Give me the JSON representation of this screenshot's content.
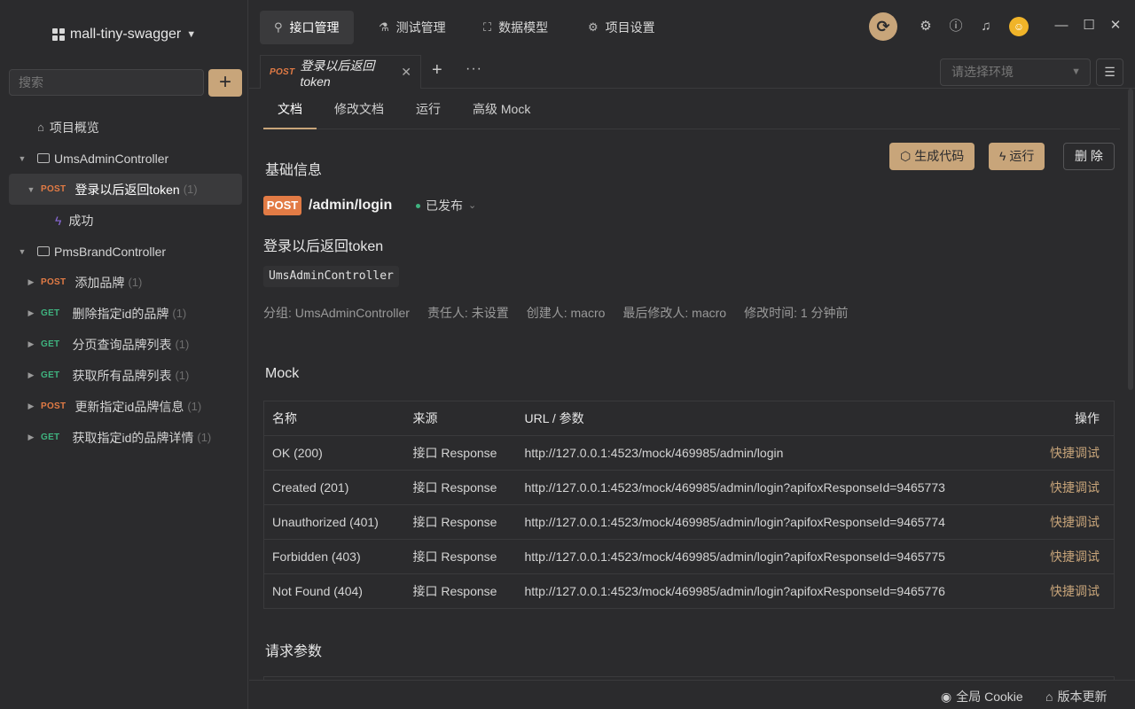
{
  "project": {
    "name": "mall-tiny-swagger"
  },
  "search": {
    "placeholder": "搜索"
  },
  "add_label": "+",
  "tree": [
    {
      "kind": "overview",
      "label": "项目概览"
    },
    {
      "kind": "folder",
      "label": "UmsAdminController"
    },
    {
      "kind": "api",
      "method": "POST",
      "label": "登录以后返回token",
      "count": "(1)",
      "active": true
    },
    {
      "kind": "case",
      "label": "成功"
    },
    {
      "kind": "folder",
      "label": "PmsBrandController"
    },
    {
      "kind": "api",
      "method": "POST",
      "label": "添加品牌",
      "count": "(1)"
    },
    {
      "kind": "api",
      "method": "GET",
      "label": "删除指定id的品牌",
      "count": "(1)"
    },
    {
      "kind": "api",
      "method": "GET",
      "label": "分页查询品牌列表",
      "count": "(1)"
    },
    {
      "kind": "api",
      "method": "GET",
      "label": "获取所有品牌列表",
      "count": "(1)"
    },
    {
      "kind": "api",
      "method": "POST",
      "label": "更新指定id品牌信息",
      "count": "(1)"
    },
    {
      "kind": "api",
      "method": "GET",
      "label": "获取指定id的品牌详情",
      "count": "(1)"
    }
  ],
  "nav": {
    "tabs": [
      {
        "label": "接口管理",
        "icon": "link-icon"
      },
      {
        "label": "测试管理",
        "icon": "flask-icon"
      },
      {
        "label": "数据模型",
        "icon": "model-icon"
      },
      {
        "label": "项目设置",
        "icon": "gear-icon"
      }
    ]
  },
  "doctab": {
    "method": "POST",
    "label": "登录以后返回token"
  },
  "env": {
    "placeholder": "请选择环境"
  },
  "subtabs": [
    "文档",
    "修改文档",
    "运行",
    "高级 Mock"
  ],
  "doc": {
    "basic_title": "基础信息",
    "gen_code": "生成代码",
    "run": "运行",
    "delete": "删 除",
    "method": "POST",
    "path": "/admin/login",
    "status": "已发布",
    "name": "登录以后返回token",
    "tag": "UmsAdminController",
    "meta": {
      "group": "分组: UmsAdminController",
      "owner": "责任人: 未设置",
      "creator": "创建人:  macro",
      "modifier": "最后修改人:  macro",
      "modified": "修改时间: 1 分钟前"
    },
    "mock_title": "Mock",
    "mock_headers": [
      "名称",
      "来源",
      "URL / 参数",
      "操作"
    ],
    "mock_rows": [
      {
        "name": "OK (200)",
        "source": "接口 Response",
        "url": "http://127.0.0.1:4523/mock/469985/admin/login",
        "op": "快捷调试"
      },
      {
        "name": "Created (201)",
        "source": "接口 Response",
        "url": "http://127.0.0.1:4523/mock/469985/admin/login?apifoxResponseId=9465773",
        "op": "快捷调试"
      },
      {
        "name": "Unauthorized (401)",
        "source": "接口 Response",
        "url": "http://127.0.0.1:4523/mock/469985/admin/login?apifoxResponseId=9465774",
        "op": "快捷调试"
      },
      {
        "name": "Forbidden (403)",
        "source": "接口 Response",
        "url": "http://127.0.0.1:4523/mock/469985/admin/login?apifoxResponseId=9465775",
        "op": "快捷调试"
      },
      {
        "name": "Not Found (404)",
        "source": "接口 Response",
        "url": "http://127.0.0.1:4523/mock/469985/admin/login?apifoxResponseId=9465776",
        "op": "快捷调试"
      }
    ],
    "req_title": "请求参数"
  },
  "footer": {
    "cookie": "全局 Cookie",
    "update": "版本更新"
  },
  "colors": {
    "accent": "#c8a57a",
    "post": "#e27b45",
    "get": "#3fb37f",
    "bg": "#2b2b2d"
  }
}
